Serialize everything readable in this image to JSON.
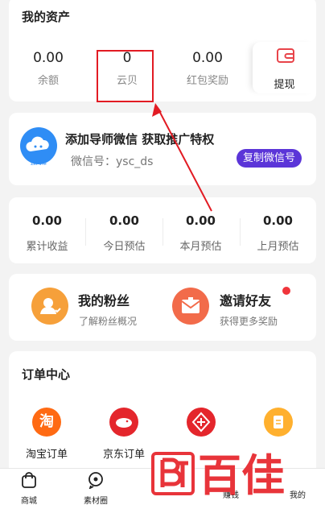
{
  "assets": {
    "title": "我的资产",
    "items": [
      {
        "value": "0.00",
        "label": "余额"
      },
      {
        "value": "0",
        "label": "云贝"
      },
      {
        "value": "0.00",
        "label": "红包奖励"
      }
    ],
    "withdraw_label": "提现"
  },
  "mentor": {
    "logo_label": "云闪荐",
    "title": "添加导师微信 获取推广特权",
    "wechat_id": "微信号：ysc_ds",
    "copy_button": "复制微信号"
  },
  "earnings": {
    "items": [
      {
        "value": "0.00",
        "label": "累计收益"
      },
      {
        "value": "0.00",
        "label": "今日预估"
      },
      {
        "value": "0.00",
        "label": "本月预估"
      },
      {
        "value": "0.00",
        "label": "上月预估"
      }
    ]
  },
  "social": {
    "fans": {
      "title": "我的粉丝",
      "subtitle": "了解粉丝概况",
      "icon": "user-icon"
    },
    "invite": {
      "title": "邀请好友",
      "subtitle": "获得更多奖励",
      "icon": "envelope-icon"
    }
  },
  "orders": {
    "title": "订单中心",
    "items": [
      {
        "label": "淘宝订单",
        "glyph": "淘",
        "color": "#ff6a13"
      },
      {
        "label": "京东订单",
        "color": "#e4262c"
      },
      {
        "color": "#e4262c"
      },
      {
        "color": "#ffb02e"
      }
    ]
  },
  "bottom_nav": {
    "items": [
      {
        "label": "商城",
        "icon": "bag-icon"
      },
      {
        "label": "素材圈",
        "icon": "chat-icon"
      },
      {
        "label": "赚钱"
      },
      {
        "label": "我的"
      }
    ]
  },
  "watermark": {
    "text": "百佳"
  },
  "colors": {
    "accent_purple": "#5b35d8",
    "highlight_red": "#e21b23",
    "orange": "#f6a03a",
    "red_dot": "#f0353b"
  }
}
